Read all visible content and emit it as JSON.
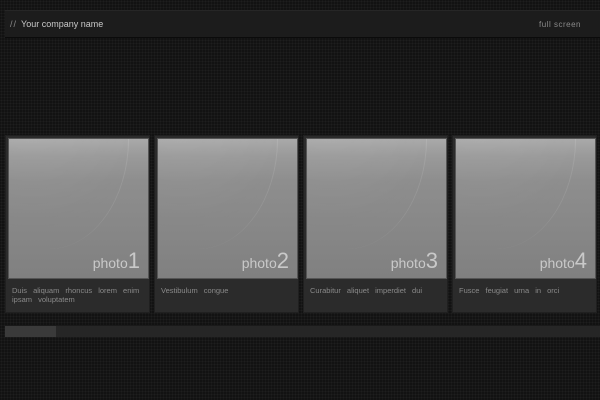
{
  "header": {
    "slashes": "//",
    "company_name": "Your company name",
    "fullscreen_label": "full screen"
  },
  "gallery": {
    "items": [
      {
        "word": "photo",
        "number": "1",
        "caption": "Duis aliquam rhoncus lorem enim ipsam voluptatem"
      },
      {
        "word": "photo",
        "number": "2",
        "caption": "Vestibulum congue"
      },
      {
        "word": "photo",
        "number": "3",
        "caption": "Curabitur aliquet imperdiet dui"
      },
      {
        "word": "photo",
        "number": "4",
        "caption": "Fusce feugiat urna in orci"
      }
    ]
  },
  "scrollbar": {
    "position": 0,
    "visible_fraction": 0.085
  },
  "colors": {
    "background": "#121212",
    "header": "#1c1c1c",
    "card": "#2b2b2b",
    "thumbnail": "#8e8e8e",
    "text_light": "#c8c8c8",
    "text_dim": "#8a8a8a"
  }
}
